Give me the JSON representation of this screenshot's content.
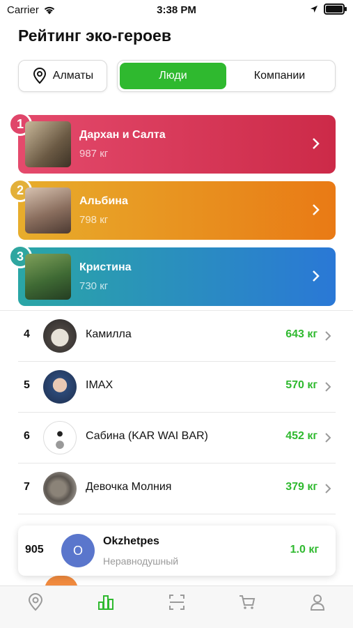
{
  "status_bar": {
    "carrier": "Carrier",
    "time": "3:38 PM"
  },
  "title": "Рейтинг эко-героев",
  "city": {
    "label": "Алматы"
  },
  "segment": {
    "people": "Люди",
    "companies": "Компании",
    "selected": "people"
  },
  "top": [
    {
      "rank": "1",
      "name": "Дархан и Салта",
      "kg": "987 кг",
      "color_from": "#e44a6c",
      "color_to": "#cc2a48"
    },
    {
      "rank": "2",
      "name": "Альбина",
      "kg": "798 кг",
      "color_from": "#e7ad2c",
      "color_to": "#e97a15"
    },
    {
      "rank": "3",
      "name": "Кристина",
      "kg": "730 кг",
      "color_from": "#2aa6a6",
      "color_to": "#2a78d6"
    }
  ],
  "list": [
    {
      "rank": "4",
      "name": "Камилла",
      "kg": "643 кг"
    },
    {
      "rank": "5",
      "name": "IMAX",
      "kg": "570 кг"
    },
    {
      "rank": "6",
      "name": "Сабина (KAR WAI BAR)",
      "kg": "452 кг"
    },
    {
      "rank": "7",
      "name": "Девочка Молния",
      "kg": "379 кг"
    }
  ],
  "me": {
    "rank": "905",
    "initial": "O",
    "name": "Okzhetpes",
    "status": "Неравнодушный",
    "kg": "1.0 кг"
  },
  "colors": {
    "accent": "#2fb92f",
    "me_avatar": "#5a76cc"
  },
  "tabs": [
    "map-pin-icon",
    "ranking-chart-icon",
    "scan-icon",
    "cart-icon",
    "profile-icon"
  ]
}
